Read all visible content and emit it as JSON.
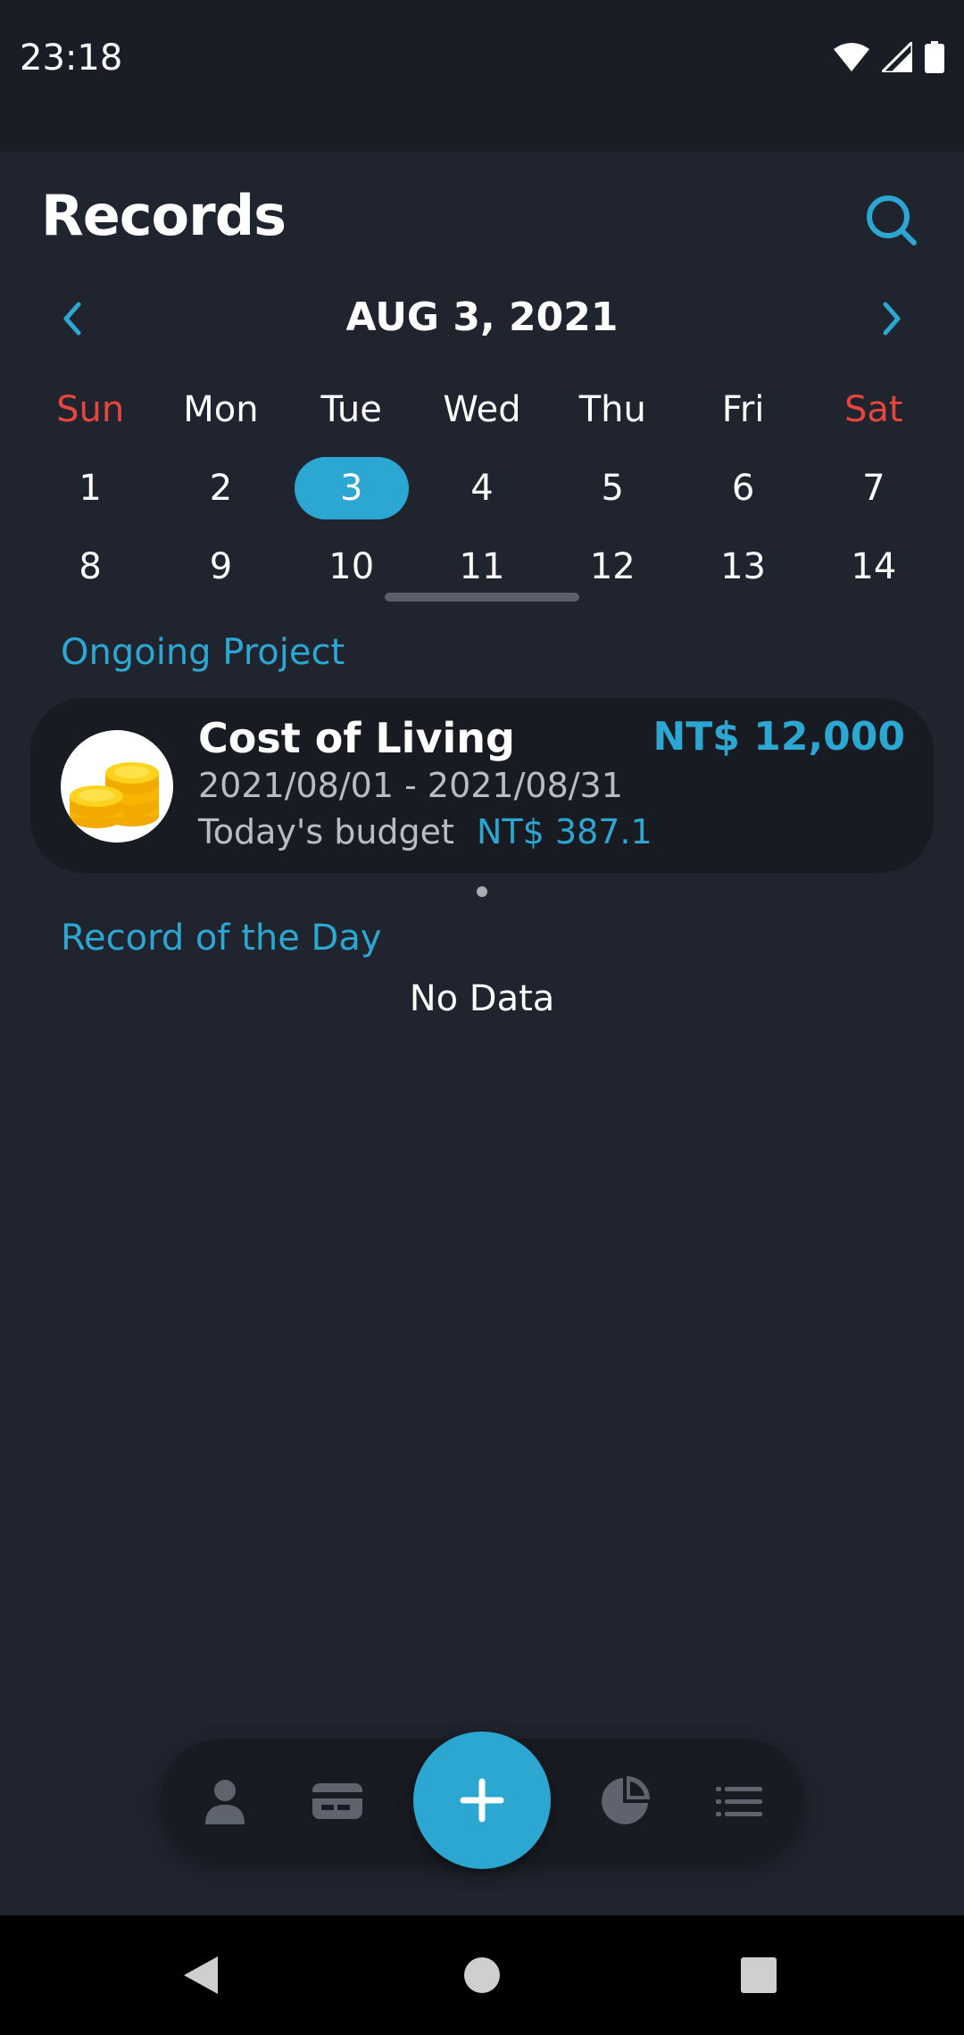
{
  "status_bar": {
    "time": "23:18"
  },
  "header": {
    "title": "Records"
  },
  "calendar": {
    "month_label": "AUG 3, 2021",
    "weekdays": [
      "Sun",
      "Mon",
      "Tue",
      "Wed",
      "Thu",
      "Fri",
      "Sat"
    ],
    "week1": [
      "1",
      "2",
      "3",
      "4",
      "5",
      "6",
      "7"
    ],
    "week2": [
      "8",
      "9",
      "10",
      "11",
      "12",
      "13",
      "14"
    ],
    "selected_day": "3"
  },
  "ongoing": {
    "section_title": "Ongoing Project",
    "project": {
      "name": "Cost of Living",
      "amount": "NT$ 12,000",
      "dates": "2021/08/01 - 2021/08/31",
      "budget_label": "Today's budget",
      "budget_value": "NT$ 387.1"
    }
  },
  "day_records": {
    "section_title": "Record of the Day",
    "empty_text": "No Data"
  },
  "bottom_nav": {
    "items": [
      "person-icon",
      "card-icon",
      "add-icon",
      "pie-chart-icon",
      "list-icon"
    ]
  },
  "colors": {
    "accent": "#2ba7d2",
    "weekend": "#e8453c",
    "background": "#20242f",
    "card": "#181b22"
  }
}
